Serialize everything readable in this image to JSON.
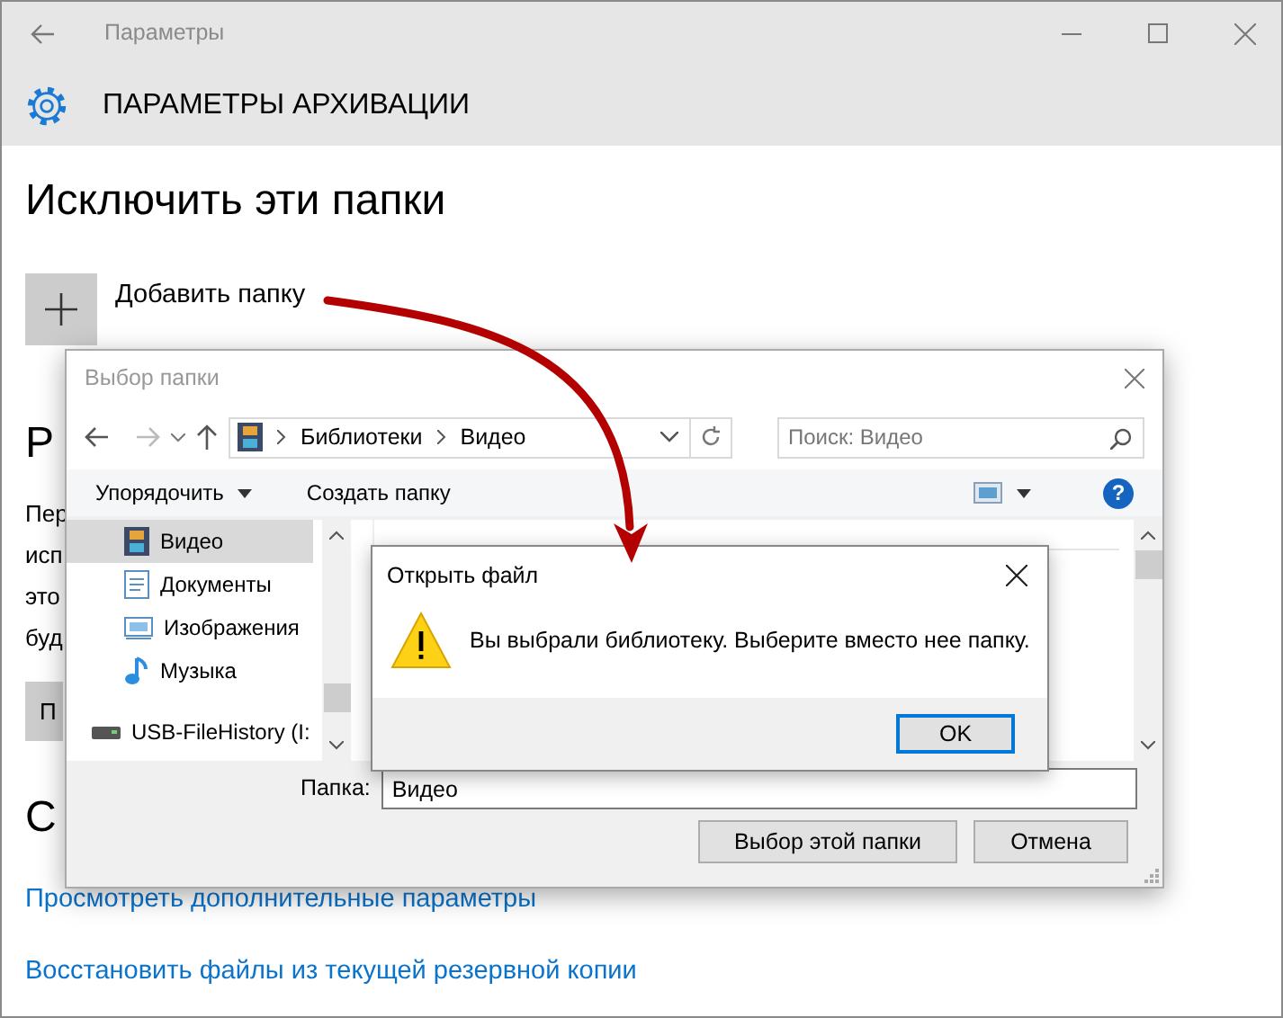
{
  "window": {
    "title": "Параметры"
  },
  "header": {
    "title": "ПАРАМЕТРЫ АРХИВАЦИИ"
  },
  "page": {
    "heading": "Исключить эти папки",
    "add_folder_label": "Добавить папку",
    "section_heading_1": "Р",
    "paragraph_lines": [
      "Пер",
      "исп",
      "это",
      "буд"
    ],
    "button_1": "П",
    "section_heading_2": "С",
    "links": [
      "Просмотреть дополнительные параметры",
      "Восстановить файлы из текущей резервной копии"
    ]
  },
  "folder_dialog": {
    "title": "Выбор папки",
    "breadcrumbs": [
      "Библиотеки",
      "Видео"
    ],
    "search": {
      "placeholder": "Поиск: Видео"
    },
    "toolbar": {
      "organize": "Упорядочить",
      "new_folder": "Создать папку",
      "help": "?"
    },
    "nav_items": [
      {
        "label": "Видео",
        "kind": "video",
        "selected": true
      },
      {
        "label": "Документы",
        "kind": "documents",
        "selected": false
      },
      {
        "label": "Изображения",
        "kind": "pictures",
        "selected": false
      },
      {
        "label": "Музыка",
        "kind": "music",
        "selected": false
      },
      {
        "label": "USB-FileHistory (I:",
        "kind": "drive",
        "selected": false
      }
    ],
    "folder_label": "Папка:",
    "folder_value": "Видео",
    "buttons": [
      "Выбор этой папки",
      "Отмена"
    ]
  },
  "message_box": {
    "title": "Открыть файл",
    "message": "Вы выбрали библиотеку. Выберите вместо нее папку.",
    "button": "OK"
  }
}
